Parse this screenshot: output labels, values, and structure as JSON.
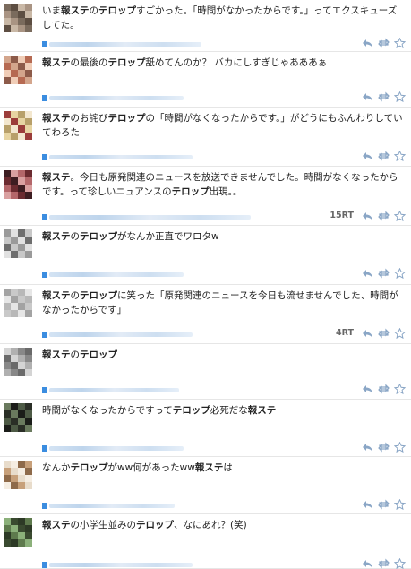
{
  "colors": {
    "accent": "#3b8de0",
    "icon": "#8aa6c6",
    "divider": "#e6e6e6"
  },
  "icons": [
    "reply-icon",
    "retweet-icon",
    "favorite-star-icon"
  ],
  "tweets": [
    {
      "parts": [
        {
          "t": "いま"
        },
        {
          "t": "報ステ",
          "b": true
        },
        {
          "t": "の"
        },
        {
          "t": "テロップ",
          "b": true
        },
        {
          "t": "すごかった。「時間がなかったからです。」ってエクスキューズしてた。"
        }
      ],
      "rt": ""
    },
    {
      "parts": [
        {
          "t": "報ステ",
          "b": true
        },
        {
          "t": "の最後の"
        },
        {
          "t": "テロップ",
          "b": true
        },
        {
          "t": "舐めてんのか？ バカにしすぎじゃあああぁ"
        }
      ],
      "rt": ""
    },
    {
      "parts": [
        {
          "t": "報ステ",
          "b": true
        },
        {
          "t": "のお詫び"
        },
        {
          "t": "テロップ",
          "b": true
        },
        {
          "t": "の「時間がなくなったからです。」がどうにもふんわりしていてわろた"
        }
      ],
      "rt": ""
    },
    {
      "parts": [
        {
          "t": "報ステ",
          "b": true
        },
        {
          "t": "。今日も原発関連のニュースを放送できませんでした。時間がなくなったからです。って珍しいニュアンスの"
        },
        {
          "t": "テロップ",
          "b": true
        },
        {
          "t": "出現。。"
        }
      ],
      "rt": "15RT"
    },
    {
      "parts": [
        {
          "t": "報ステ",
          "b": true
        },
        {
          "t": "の"
        },
        {
          "t": "テロップ",
          "b": true
        },
        {
          "t": "がなんか正直でワロタw"
        }
      ],
      "rt": ""
    },
    {
      "parts": [
        {
          "t": "報ステ",
          "b": true
        },
        {
          "t": "の"
        },
        {
          "t": "テロップ",
          "b": true
        },
        {
          "t": "に笑った「原発関連のニュースを今日も流せませんでした、時間がなかったからです」"
        }
      ],
      "rt": "4RT"
    },
    {
      "parts": [
        {
          "t": "報ステ",
          "b": true
        },
        {
          "t": "の"
        },
        {
          "t": "テロップ",
          "b": true
        }
      ],
      "rt": ""
    },
    {
      "parts": [
        {
          "t": "時間がなくなったからですって"
        },
        {
          "t": "テロップ",
          "b": true
        },
        {
          "t": "必死だな"
        },
        {
          "t": "報ステ",
          "b": true
        }
      ],
      "rt": ""
    },
    {
      "parts": [
        {
          "t": "なんか"
        },
        {
          "t": "テロップ",
          "b": true
        },
        {
          "t": "がww何があったww"
        },
        {
          "t": "報ステ",
          "b": true
        },
        {
          "t": "は"
        }
      ],
      "rt": ""
    },
    {
      "parts": [
        {
          "t": "報ステ",
          "b": true
        },
        {
          "t": "の小学生並みの"
        },
        {
          "t": "テロップ",
          "b": true
        },
        {
          "t": "、なにあれ？(笑)"
        }
      ],
      "rt": ""
    }
  ]
}
